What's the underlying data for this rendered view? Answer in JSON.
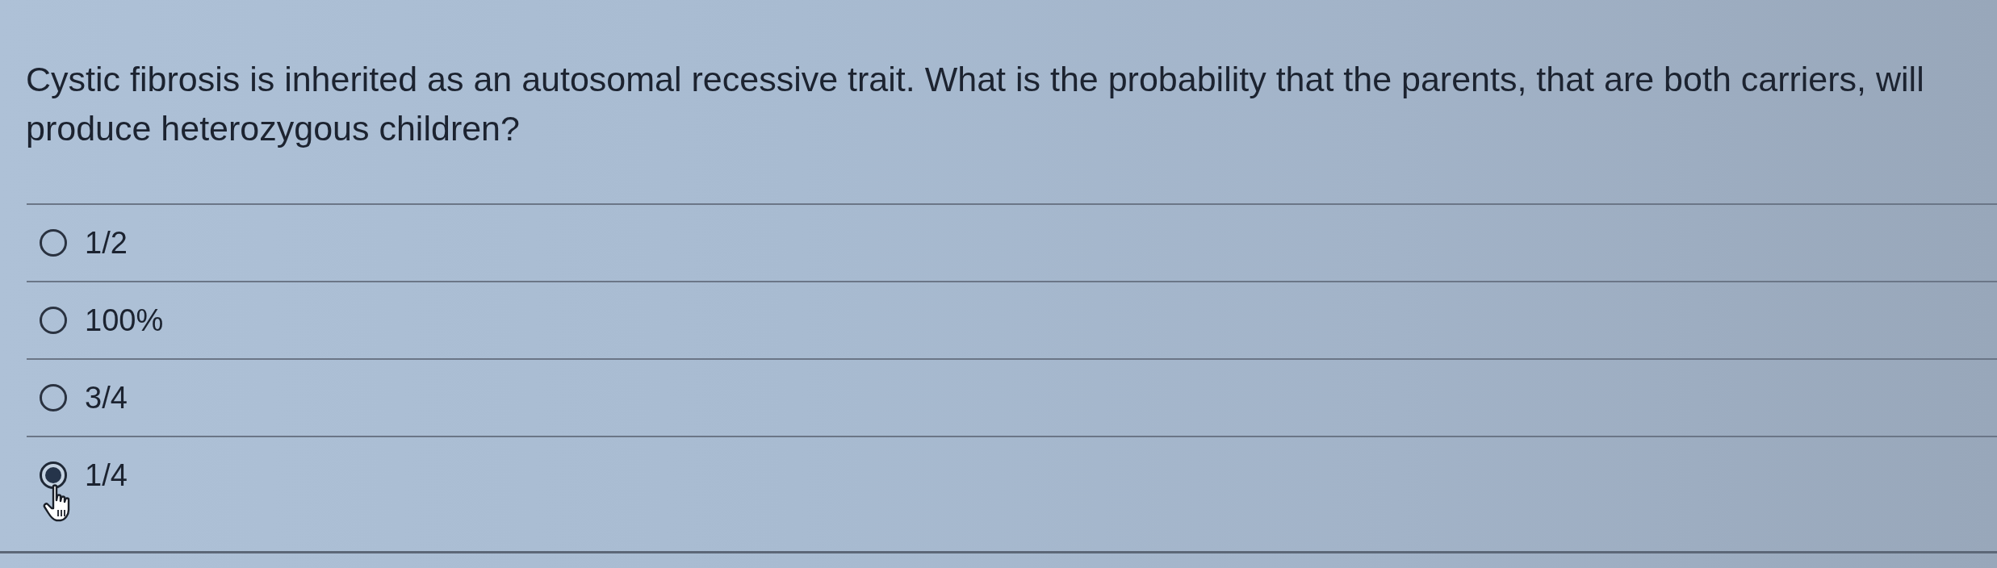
{
  "question": {
    "text": "Cystic fibrosis is inherited as an autosomal recessive trait. What is the probability that the parents, that are both carriers, will produce heterozygous children?"
  },
  "options": [
    {
      "label": "1/2",
      "selected": false
    },
    {
      "label": "100%",
      "selected": false
    },
    {
      "label": "3/4",
      "selected": false
    },
    {
      "label": "1/4",
      "selected": true
    }
  ]
}
